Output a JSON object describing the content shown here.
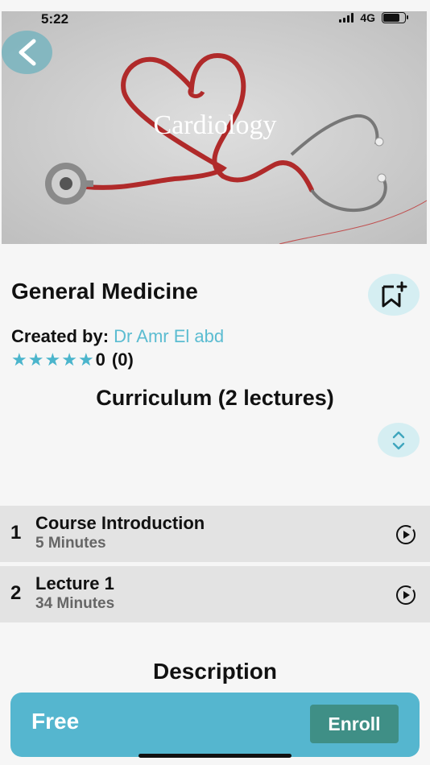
{
  "status_bar": {
    "time": "5:22",
    "network": "4G",
    "battery_level": 0.78
  },
  "hero": {
    "image_caption": "Cardiology",
    "icon": "stethoscope-heart-image"
  },
  "header": {
    "back_icon": "chevron-left-icon"
  },
  "course": {
    "title": "General Medicine",
    "created_by_label": "Created by:",
    "author": "Dr Amr El abd",
    "rating_stars": 5,
    "rating_value": "0",
    "rating_count": "(0)",
    "bookmark_icon": "bookmark-add-icon"
  },
  "curriculum": {
    "title": "Curriculum (2 lectures)",
    "expand_icon": "expand-collapse-icon",
    "lectures": [
      {
        "number": "1",
        "name": "Course Introduction",
        "duration": "5 Minutes"
      },
      {
        "number": "2",
        "name": "Lecture 1",
        "duration": "34  Minutes"
      }
    ]
  },
  "description": {
    "title": "Description"
  },
  "purchase": {
    "price": "Free",
    "enroll_label": "Enroll"
  },
  "colors": {
    "accent": "#55b6cf",
    "author_link": "#5bbcd1",
    "star": "#4bb5cc",
    "enroll_button": "#3f8f86",
    "icon_bubble": "#d5eef2"
  }
}
